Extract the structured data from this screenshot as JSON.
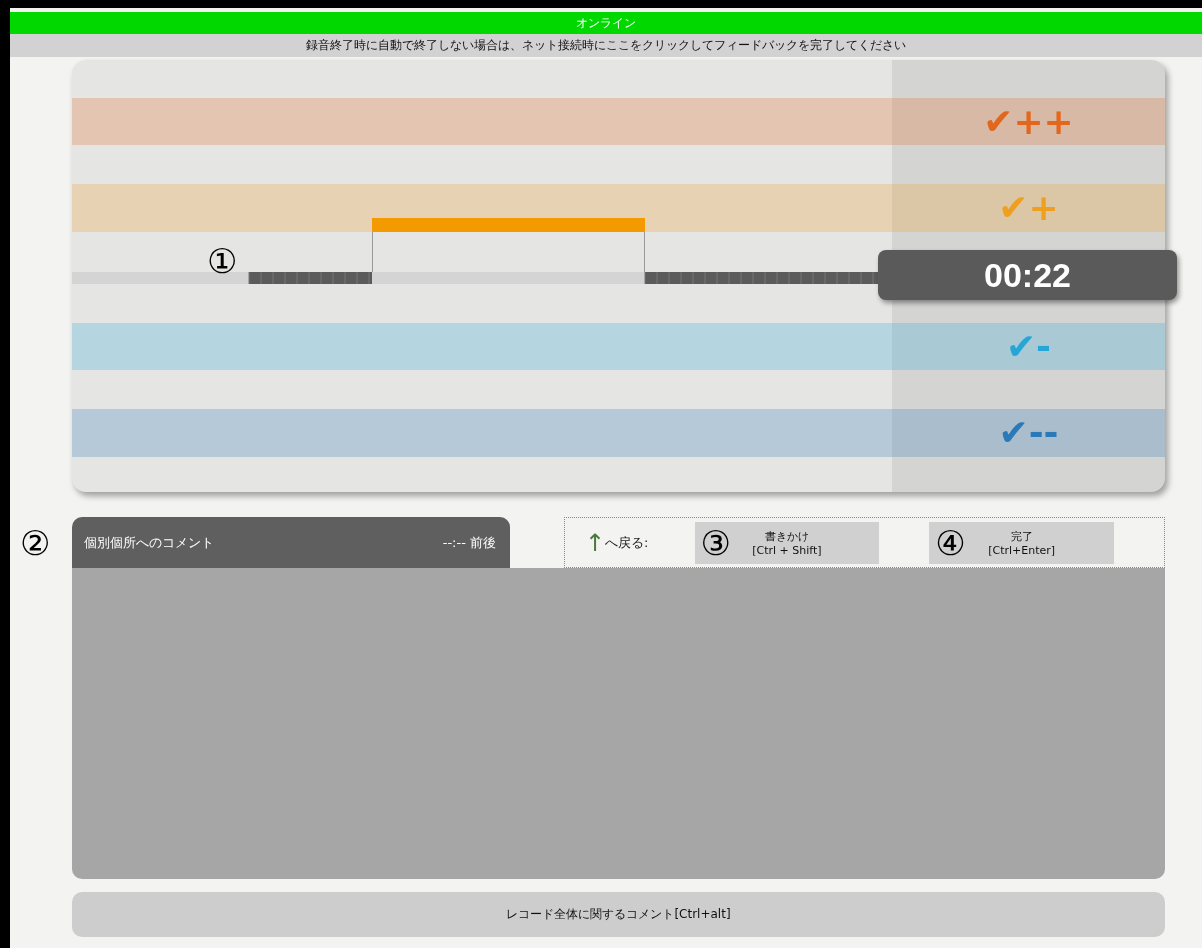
{
  "status_bar": {
    "text": "オンライン",
    "online": true
  },
  "notice": "録音終了時に自動で終了しない場合は、ネット接続時にここをクリックしてフィードバックを完了してください",
  "ratings": [
    {
      "check": "✔",
      "label": "++",
      "color": "#e2661c"
    },
    {
      "check": "✔",
      "label": "+",
      "color": "#ef9f1e"
    },
    {
      "check": "✔",
      "label": "-",
      "color": "#26a6d6"
    },
    {
      "check": "✔",
      "label": "--",
      "color": "#2a79b8"
    }
  ],
  "timeline": {
    "marker": "①",
    "time": "00:22"
  },
  "comment": {
    "marker": "②",
    "title": "個別個所へのコメント",
    "time": "--:-- 前後"
  },
  "toolbar": {
    "arrow": "↑",
    "back": "へ戻る:",
    "buttons": [
      {
        "marker": "③",
        "label": "書きかけ",
        "shortcut": "[Ctrl + Shift]"
      },
      {
        "marker": "④",
        "label": "完了",
        "shortcut": "[Ctrl+Enter]"
      }
    ]
  },
  "overall_comment": "レコード全体に関するコメント[Ctrl+alt]"
}
